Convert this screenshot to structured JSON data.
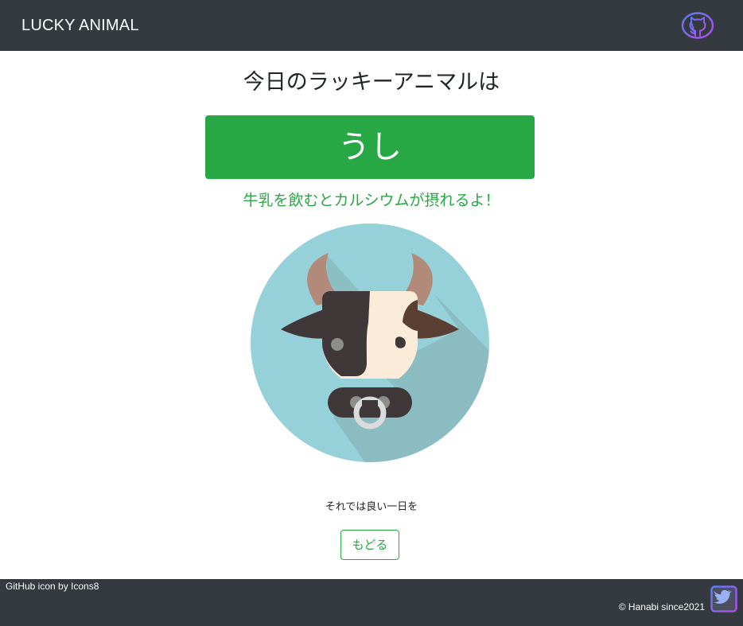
{
  "navbar": {
    "brand": "LUCKY ANIMAL",
    "github_icon": "github-icon"
  },
  "main": {
    "heading": "今日のラッキーアニマルは",
    "animal_name": "うし",
    "animal_message": "牛乳を飲むとカルシウムが摂れるよ！",
    "animal_image": "cow-icon",
    "farewell": "それでは良い一日を",
    "back_button": "もどる"
  },
  "footer": {
    "credit": "GitHub icon by Icons8",
    "copyright": "© Hanabi since2021",
    "twitter_icon": "twitter-icon"
  },
  "colors": {
    "navbar_bg": "#343a40",
    "accent_green": "#28a745",
    "icon_circle": "#96d1d9",
    "icon_gradient_start": "#5b7cf5",
    "icon_gradient_end": "#b54be6"
  }
}
